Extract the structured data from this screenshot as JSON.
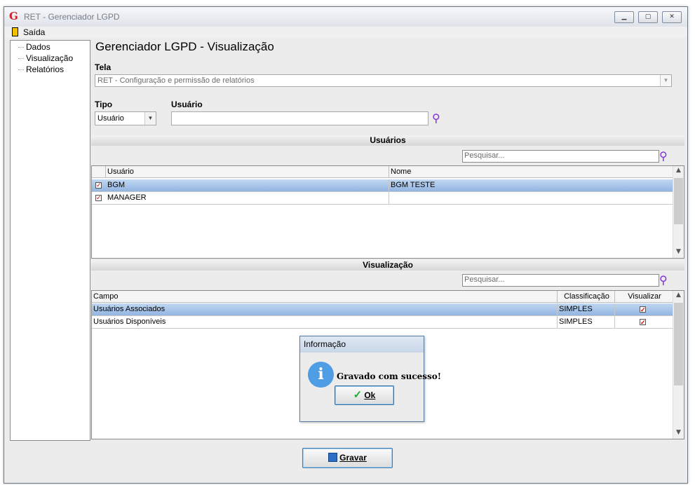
{
  "window": {
    "title": "RET - Gerenciador LGPD",
    "controls": [
      "minimize-icon",
      "maximize-icon",
      "close-icon"
    ]
  },
  "menu": {
    "exit_label": "Saída"
  },
  "nav": {
    "items": [
      "Dados",
      "Visualização",
      "Relatórios"
    ]
  },
  "main": {
    "title": "Gerenciador LGPD - Visualização",
    "tela_label": "Tela",
    "tela_value": "RET - Configuração e permissão de relatórios",
    "tipo_label": "Tipo",
    "tipo_value": "Usuário",
    "usuario_label": "Usuário",
    "usuario_value": ""
  },
  "usuarios": {
    "section_title": "Usuários",
    "search_placeholder": "Pesquisar...",
    "columns": [
      "Usuário",
      "Nome"
    ],
    "rows": [
      {
        "checked": true,
        "usuario": "BGM",
        "nome": "BGM TESTE",
        "selected": true
      },
      {
        "checked": true,
        "usuario": "MANAGER",
        "nome": "",
        "selected": false
      }
    ]
  },
  "visualizacao": {
    "section_title": "Visualização",
    "search_placeholder": "Pesquisar...",
    "columns": [
      "Campo",
      "Classificação",
      "Visualizar"
    ],
    "rows": [
      {
        "campo": "Usuários Associados",
        "classificacao": "SIMPLES",
        "visualizar": true,
        "selected": true
      },
      {
        "campo": "Usuários Disponíveis",
        "classificacao": "SIMPLES",
        "visualizar": true,
        "selected": false
      }
    ]
  },
  "dialog": {
    "title": "Informação",
    "message": "Gravado com sucesso!",
    "ok_label": "Ok"
  },
  "footer": {
    "save_label": "Gravar"
  },
  "colors": {
    "selection": "#93b5e2",
    "accent": "#3c7fb1",
    "info": "#4f9de5",
    "search_icon": "#7c2bd9"
  }
}
